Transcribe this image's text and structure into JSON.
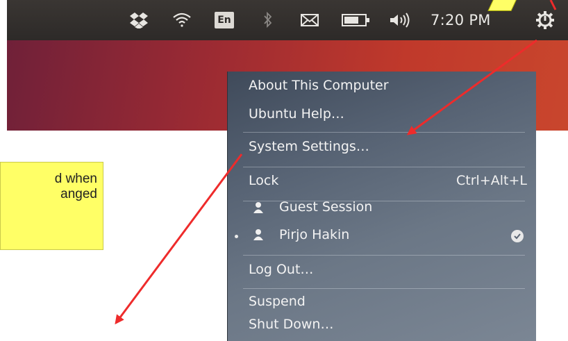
{
  "topbar": {
    "keyboard_indicator": "En",
    "clock": "7:20 PM",
    "icons": [
      "dropbox-icon",
      "wifi-icon",
      "bluetooth-icon",
      "mail-icon",
      "battery-icon",
      "volume-icon",
      "power-gear-icon"
    ]
  },
  "callout": {
    "line1": "d when",
    "line2": "anged"
  },
  "menu": {
    "items": [
      {
        "label": "About This Computer"
      },
      {
        "label": "Ubuntu Help…"
      },
      {
        "label": "System Settings…"
      },
      {
        "label": "Lock",
        "accel": "Ctrl+Alt+L"
      },
      {
        "label": "Guest Session"
      },
      {
        "label": "Pirjo Hakin"
      },
      {
        "label": "Log Out…"
      },
      {
        "label": "Suspend"
      },
      {
        "label": "Shut Down…"
      }
    ]
  },
  "colors": {
    "arrow": "#ee2b2b",
    "callout": "#ffff66",
    "topbar": "#2d2a28"
  }
}
